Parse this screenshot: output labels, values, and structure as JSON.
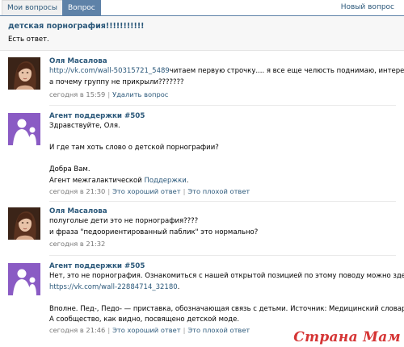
{
  "tabs": {
    "my_questions": "Мои вопросы",
    "question": "Вопрос",
    "new_question": "Новый вопрос"
  },
  "topic": {
    "title": "детская порнография!!!!!!!!!!!",
    "subtitle": "Есть ответ."
  },
  "messages": [
    {
      "author": "Оля Масалова",
      "link": "http://vk.com/wall-50315721_5489",
      "line1_rest": "читаем первую строчку.... я все еще челюсть поднимаю, интересно,",
      "line2": "а почему группу не прикрыли???????",
      "time": "сегодня в 15:59",
      "action": "Удалить вопрос"
    },
    {
      "author": "Агент поддержки #505",
      "lines": [
        "Здравствуйте, Оля.",
        "",
        "И где там хоть слово о детской порнографии?",
        "",
        "Добра Вам."
      ],
      "signature_prefix": "Агент межгалактической ",
      "signature_link": "Поддержки",
      "signature_suffix": ".",
      "time": "сегодня в 21:30",
      "good": "Это хороший ответ",
      "bad": "Это плохой ответ"
    },
    {
      "author": "Оля Масалова",
      "line1": "полуголые дети это не порнография????",
      "line2": "и фраза \"педоориентированный паблик\" это нормально?",
      "time": "сегодня в 21:32"
    },
    {
      "author": "Агент поддержки #505",
      "line1": "Нет, это не порнография. Ознакомиться с нашей открытой позицией по этому поводу можно здесь:",
      "link": "https://vk.com/wall-22884714_32180",
      "link_suffix": ".",
      "line3": "Вполне. Пед-, Педо- — приставка, обозначающая связь с детьми. Источник: Медицинский словарь.",
      "line4": "А сообщество, как видно, посвящено детской моде.",
      "time": "сегодня в 21:46",
      "good": "Это хороший ответ",
      "bad": "Это плохой ответ"
    }
  ],
  "watermark": "Страна Мам",
  "icons": {
    "user_avatar": "user-photo-avatar",
    "agent_avatar": "support-agent-avatar"
  },
  "colors": {
    "link": "#2b587a",
    "tab_active": "#5e82a8",
    "agent_bg": "#8a5bc4",
    "watermark": "#d53535"
  }
}
